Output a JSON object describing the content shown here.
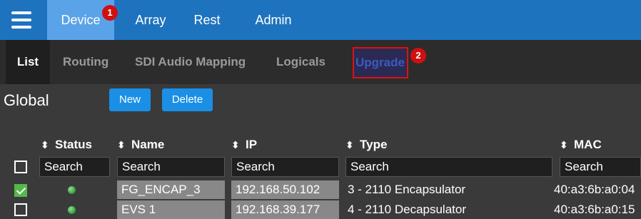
{
  "topnav": {
    "items": [
      {
        "label": "Device",
        "badge": "1",
        "active": true
      },
      {
        "label": "Array"
      },
      {
        "label": "Rest"
      },
      {
        "label": "Admin"
      }
    ]
  },
  "subnav": {
    "tabs": [
      {
        "label": "List",
        "active": true
      },
      {
        "label": "Routing"
      },
      {
        "label": "SDI Audio Mapping"
      },
      {
        "label": "Logicals"
      },
      {
        "label": "Upgrade",
        "badge": "2",
        "highlighted": true
      }
    ]
  },
  "page": {
    "title": "Global",
    "new_label": "New",
    "delete_label": "Delete"
  },
  "table": {
    "columns": [
      "Status",
      "Name",
      "IP",
      "Type",
      "MAC"
    ],
    "filter_placeholder": "Search",
    "rows": [
      {
        "checked": true,
        "status": "online",
        "name": "FG_ENCAP_3",
        "ip": "192.168.50.102",
        "type": "3 - 2110 Encapsulator",
        "mac": "40:a3:6b:a0:04"
      },
      {
        "checked": false,
        "status": "online",
        "name": "EVS 1",
        "ip": "192.168.39.177",
        "type": "4 - 2110 Decapsulator",
        "mac": "40:a3:6b:a0:15"
      }
    ]
  },
  "colors": {
    "topnav": "#1e73be",
    "active_tab": "#5ba3e8",
    "badge": "#d01010",
    "button": "#1b8fe6",
    "highlight_border": "#e01010"
  }
}
